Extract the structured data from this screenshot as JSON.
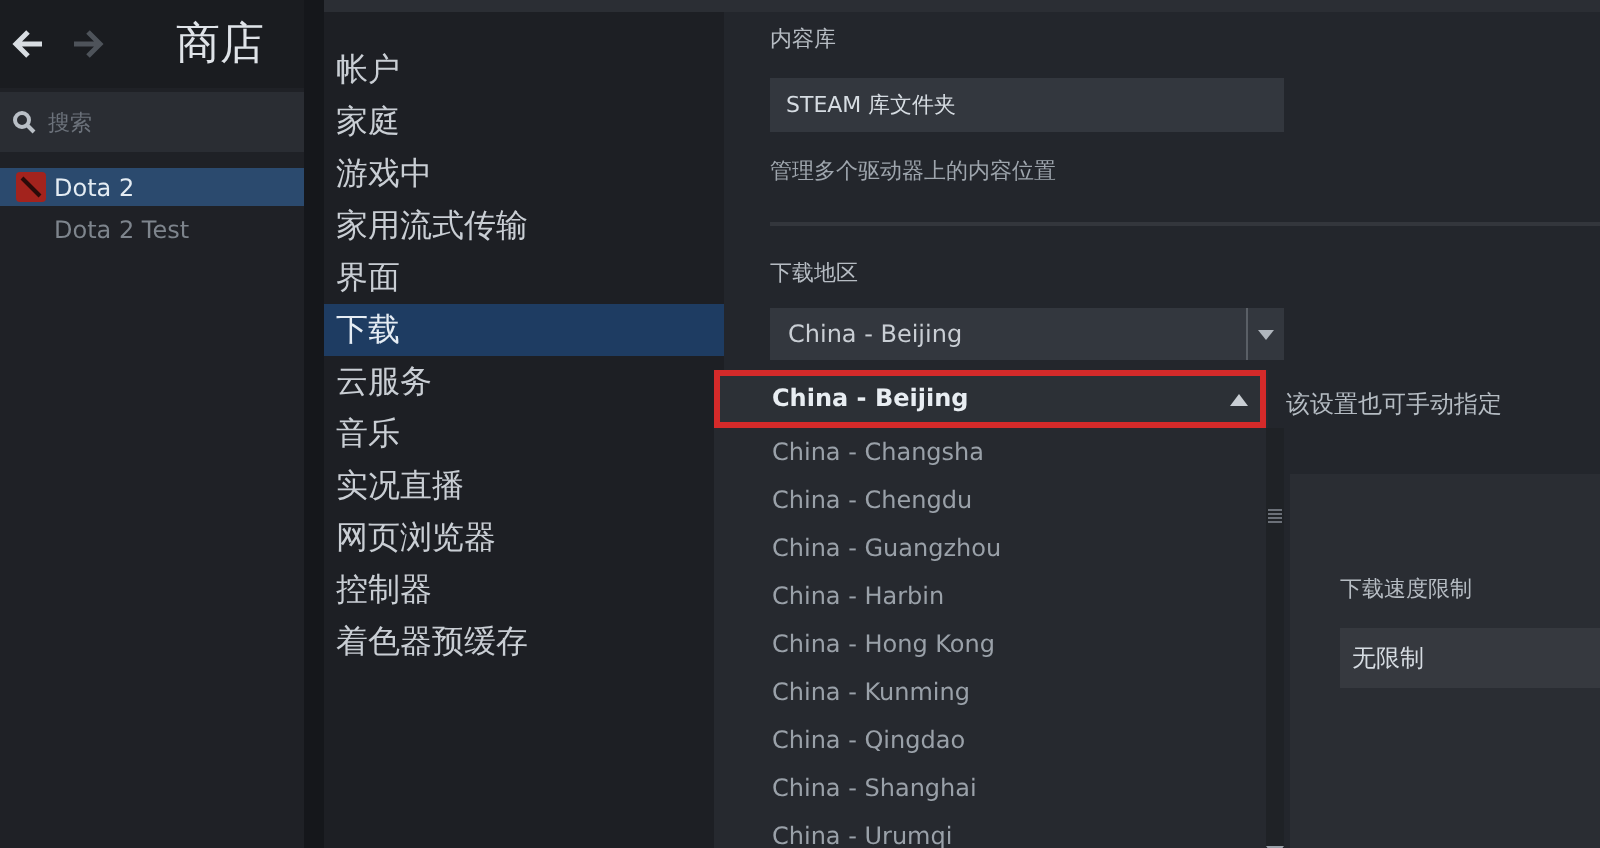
{
  "library": {
    "nav": {
      "title": "商店"
    },
    "search": {
      "placeholder": "搜索"
    },
    "games": [
      {
        "name": "Dota 2",
        "selected": true,
        "has_icon": true
      },
      {
        "name": "Dota 2 Test",
        "selected": false,
        "has_icon": false
      }
    ]
  },
  "settings": {
    "sections": [
      {
        "label": "帐户",
        "selected": false
      },
      {
        "label": "家庭",
        "selected": false
      },
      {
        "label": "游戏中",
        "selected": false
      },
      {
        "label": "家用流式传输",
        "selected": false
      },
      {
        "label": "界面",
        "selected": false
      },
      {
        "label": "下载",
        "selected": true
      },
      {
        "label": "云服务",
        "selected": false
      },
      {
        "label": "音乐",
        "selected": false
      },
      {
        "label": "实况直播",
        "selected": false
      },
      {
        "label": "网页浏览器",
        "selected": false
      },
      {
        "label": "控制器",
        "selected": false
      },
      {
        "label": "着色器预缓存",
        "selected": false
      }
    ],
    "content_library": {
      "heading": "内容库",
      "button": "STEAM 库文件夹",
      "description": "管理多个驱动器上的内容位置"
    },
    "download_region": {
      "heading": "下载地区",
      "value": "China - Beijing",
      "hint": "该设置也可手动指定",
      "options": [
        {
          "label": "China - Beijing",
          "selected": true,
          "outlined": true
        },
        {
          "label": "China - Changsha",
          "selected": false,
          "outlined": false
        },
        {
          "label": "China - Chengdu",
          "selected": false,
          "outlined": false
        },
        {
          "label": "China - Guangzhou",
          "selected": false,
          "outlined": false
        },
        {
          "label": "China - Harbin",
          "selected": false,
          "outlined": false
        },
        {
          "label": "China - Hong Kong",
          "selected": false,
          "outlined": false
        },
        {
          "label": "China - Kunming",
          "selected": false,
          "outlined": false
        },
        {
          "label": "China - Qingdao",
          "selected": false,
          "outlined": false
        },
        {
          "label": "China - Shanghai",
          "selected": false,
          "outlined": false
        },
        {
          "label": "China - Urumqi",
          "selected": false,
          "outlined": false
        }
      ]
    },
    "speed_limit": {
      "heading": "下载速度限制",
      "value": "无限制"
    }
  }
}
